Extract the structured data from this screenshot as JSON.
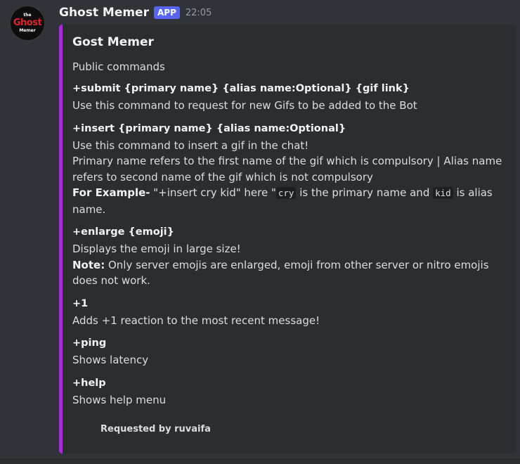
{
  "message": {
    "username": "Ghost Memer",
    "badge": "APP",
    "timestamp": "22:05",
    "avatar": {
      "line1": "the",
      "line2": "Ghost",
      "line3": "Memer"
    }
  },
  "embed": {
    "accent_color": "#a62bd8",
    "title": "Gost Memer",
    "description": "Public commands",
    "fields": [
      {
        "name": "+submit {primary name} {alias name:Optional} {gif link}",
        "value": "Use this command to request for new Gifs to be added to the Bot"
      },
      {
        "name": "+insert {primary name} {alias name:Optional}",
        "line1": "Use this command to insert a gif in the chat!",
        "line2": "Primary name refers to the first name of the gif which is compulsory | Alias name refers to second name of the gif which is not compulsory",
        "example_label": "For Example-",
        "example_text1": " \"+insert cry kid\" here \"",
        "code1": "cry",
        "example_text2": " is the primary name and ",
        "code2": "kid",
        "example_text3": " is alias name."
      },
      {
        "name": "+enlarge {emoji}",
        "line1": "Displays the emoji in large size!",
        "note_label": "Note:",
        "note_text": " Only server emojis are enlarged, emoji from other server or nitro emojis does not work."
      },
      {
        "name": "+1",
        "value": "Adds +1 reaction to the most recent message!"
      },
      {
        "name": "+ping",
        "value": "Shows latency"
      },
      {
        "name": "+help",
        "value": "Shows help menu"
      }
    ],
    "footer": "Requested by ruvaifa"
  }
}
